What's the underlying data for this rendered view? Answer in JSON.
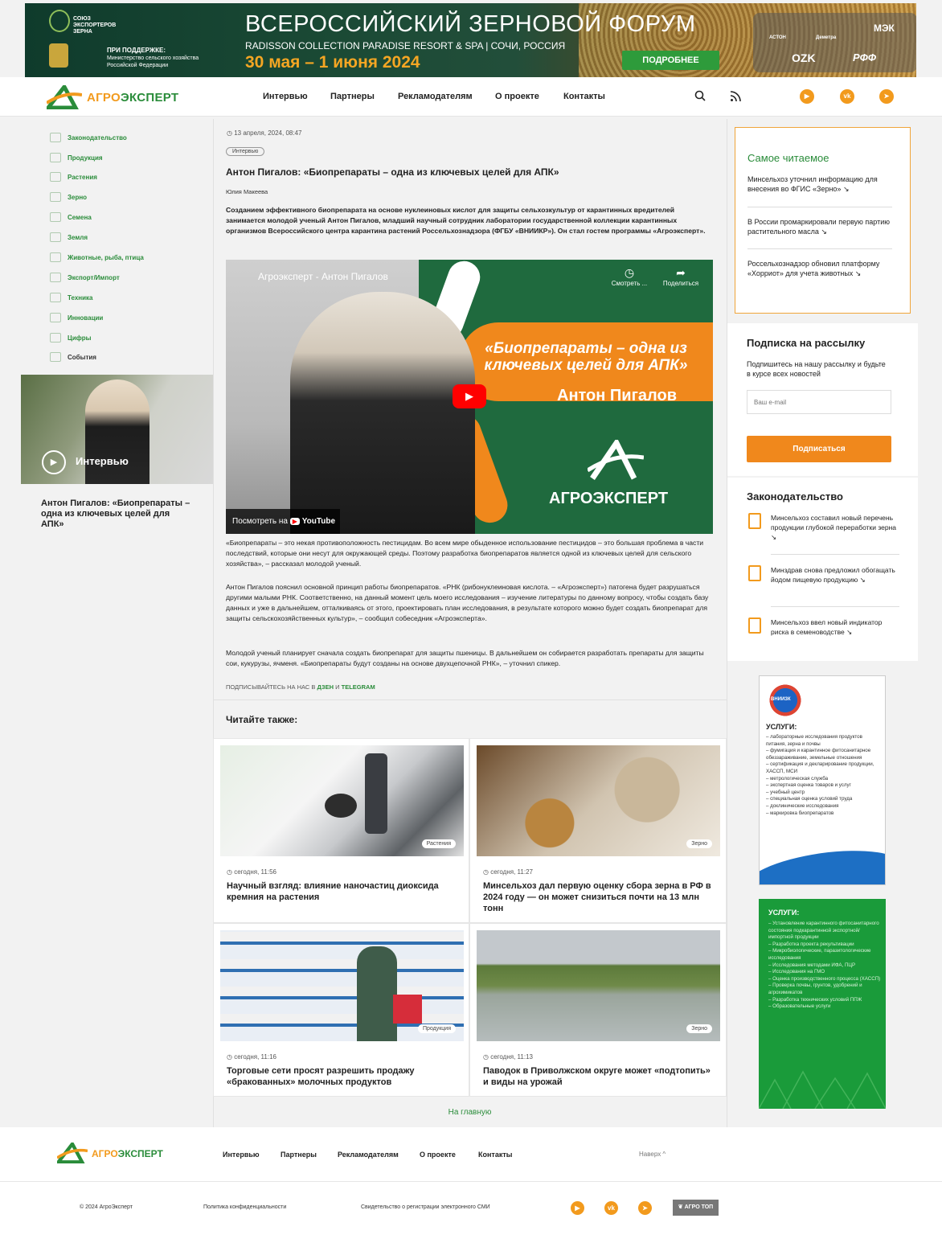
{
  "banner": {
    "union": "СОЮЗ ЭКСПОРТЕРОВ ЗЕРНА",
    "support_title": "ПРИ ПОДДЕРЖКЕ:",
    "support_text": "Министерство сельского хозяйства Российской Федерации",
    "title": "ВСЕРОССИЙСКИЙ ЗЕРНОВОЙ ФОРУМ",
    "venue": "RADISSON COLLECTION PARADISE RESORT & SPA | СОЧИ, РОССИЯ",
    "dates": "30 мая – 1 июня 2024",
    "more_button": "ПОДРОБНЕЕ",
    "partners": [
      "АСТОН",
      "Деметра",
      "МЭК",
      "OZK",
      "РФФ"
    ]
  },
  "header": {
    "logo_part1": "АГРО",
    "logo_part2": "ЭКСПЕРТ",
    "nav": [
      "Интервью",
      "Партнеры",
      "Рекламодателям",
      "О проекте",
      "Контакты"
    ],
    "social": [
      "▶",
      "vk",
      "➤"
    ]
  },
  "sidebar": {
    "items": [
      "Законодательство",
      "Продукция",
      "Растения",
      "Зерно",
      "Семена",
      "Земля",
      "Животные, рыба, птица",
      "Экспорт/Импорт",
      "Техника",
      "Инновации",
      "Цифры",
      "События"
    ],
    "photo_label": "Интервью",
    "caption": "Антон Пигалов: «Биопрепараты – одна из ключевых целей для АПК»"
  },
  "article": {
    "date": "13 апреля, 2024, 08:47",
    "tag": "Интервью",
    "title": "Антон Пигалов: «Биопрепараты – одна из ключевых целей для АПК»",
    "author": "Юлия Макеева",
    "lead": "Созданием эффективного биопрепарата на основе нуклеиновых кислот для защиты сельхозкультур от карантинных вредителей занимается молодой ученый Антон Пигалов, младший научный сотрудник лаборатории государственной коллекции карантинных организмов Всероссийского центра карантина растений Россельхознадзора (ФГБУ «ВНИИКР»). Он стал гостем программы «Агроэксперт».",
    "video": {
      "channel": "Агроэксперт - Антон Пигалов",
      "watch_later": "Смотреть ...",
      "share": "Поделиться",
      "quote": "«Биопрепараты – одна из ключевых целей для АПК»",
      "name": "Антон Пигалов",
      "brand": "АГРОЭКСПЕРТ",
      "watch_on": "Посмотреть на",
      "youtube": "YouTube"
    },
    "p1": "«Биопрепараты – это некая противоположность пестицидам. Во всем мире обыденное использование пестицидов – это большая проблема в части последствий, которые они несут для окружающей среды. Поэтому разработка биопрепаратов является одной из ключевых целей для сельского хозяйства», – рассказал молодой ученый.",
    "p2": "Антон Пигалов пояснил основной принцип работы биопрепаратов. «РНК (рибонуклеиновая кислота. – «Агроэксперт») патогена будет разрушаться другими малыми РНК. Соответственно, на данный момент цель моего исследования – изучение литературы по данному вопросу, чтобы создать базу данных и уже в дальнейшем, отталкиваясь от этого, проектировать план исследования, в результате которого можно будет создать биопрепарат для защиты сельскохозяйственных культур», – сообщил собеседник «Агроэксперта».",
    "p3": "Молодой ученый планирует сначала создать биопрепарат для защиты пшеницы. В дальнейшем он собирается разработать препараты для защиты сои, кукурузы, ячменя. «Биопрепараты будут созданы на основе двухцепочной РНК», – уточнил спикер.",
    "subscribe_prefix": "ПОДПИСЫВАЙТЕСЬ НА НАС В",
    "dzen": "ДЗЕН",
    "and": "И",
    "telegram": "TELEGRAM"
  },
  "read_also": {
    "title": "Читайте также:",
    "cards": [
      {
        "time": "сегодня, 11:56",
        "title": "Научный взгляд: влияние наночастиц диоксида кремния на растения",
        "tag": "Растения"
      },
      {
        "time": "сегодня, 11:27",
        "title": "Минсельхоз дал первую оценку сбора зерна в РФ в 2024 году — он может снизиться почти на 13 млн тонн",
        "tag": "Зерно"
      },
      {
        "time": "сегодня, 11:16",
        "title": "Торговые сети просят разрешить продажу «бракованных» молочных продуктов",
        "tag": "Продукция"
      },
      {
        "time": "сегодня, 11:13",
        "title": "Паводок в Приволжском округе может «подтопить» и виды на урожай",
        "tag": "Зерно"
      }
    ],
    "home_link": "На главную"
  },
  "popular": {
    "title": "Самое читаемое",
    "items": [
      "Минсельхоз уточнил информацию для внесения во ФГИС «Зерно» ↘",
      "В России промаркировали первую партию растительного масла ↘",
      "Россельхознадзор обновил платформу «Хорриот» для учета животных ↘"
    ]
  },
  "subscribe": {
    "title": "Подписка на рассылку",
    "text": "Подпишитесь на нашу рассылку и будьте в курсе всех новостей",
    "placeholder": "Ваш e-mail",
    "button": "Подписаться"
  },
  "law": {
    "title": "Законодательство",
    "items": [
      "Минсельхоз составил новый перечень продукции глубокой переработки зерна ↘",
      "Минздрав снова предложил обогащать йодом пищевую продукцию ↘",
      "Минсельхоз ввел новый индикатор риска в семеноводстве ↘"
    ]
  },
  "ad1": {
    "logo": "ВНИИЗК",
    "title": "УСЛУГИ:",
    "items": [
      "– лабораторные исследования продуктов питания, зерна и почвы",
      "– фумигация и карантинное фитосанитарное обеззараживание, земельные отношения",
      "– сертификация и декларирование продукции, ХАССП, МСИ",
      "– метрологическая служба",
      "– экспертная оценка товаров и услуг",
      "– учебный центр",
      "– специальная оценка условий труда",
      "– доклинические исследования",
      "– маркировка биопрепаратов"
    ]
  },
  "ad2": {
    "title": "УСЛУГИ:",
    "items": [
      "– Установление карантинного фитосанитарного состояния подкарантинной экспортной/импортной продукции",
      "– Разработка проекта рекультивации",
      "– Микробиологические, паразитологические исследования",
      "– Исследования методами ИФА, ПЦР",
      "– Исследования на ГМО",
      "– Оценка производственного процесса (ХАССП)",
      "– Проверка почвы, грунтов, удобрений и агрохимикатов",
      "– Разработка технических условий ППЖ",
      "– Образовательные услуги"
    ]
  },
  "footer": {
    "nav": [
      "Интервью",
      "Партнеры",
      "Рекламодателям",
      "О проекте",
      "Контакты"
    ],
    "to_top": "Наверх ^",
    "copyright": "© 2024 АгроЭксперт",
    "privacy": "Политика конфиденциальности",
    "certificate": "Свидетельство о регистрации электронного СМИ",
    "agrotop": "АГРО ТОП"
  },
  "colors": {
    "brand_green": "#2a8c3a",
    "brand_orange": "#f29a1d"
  }
}
